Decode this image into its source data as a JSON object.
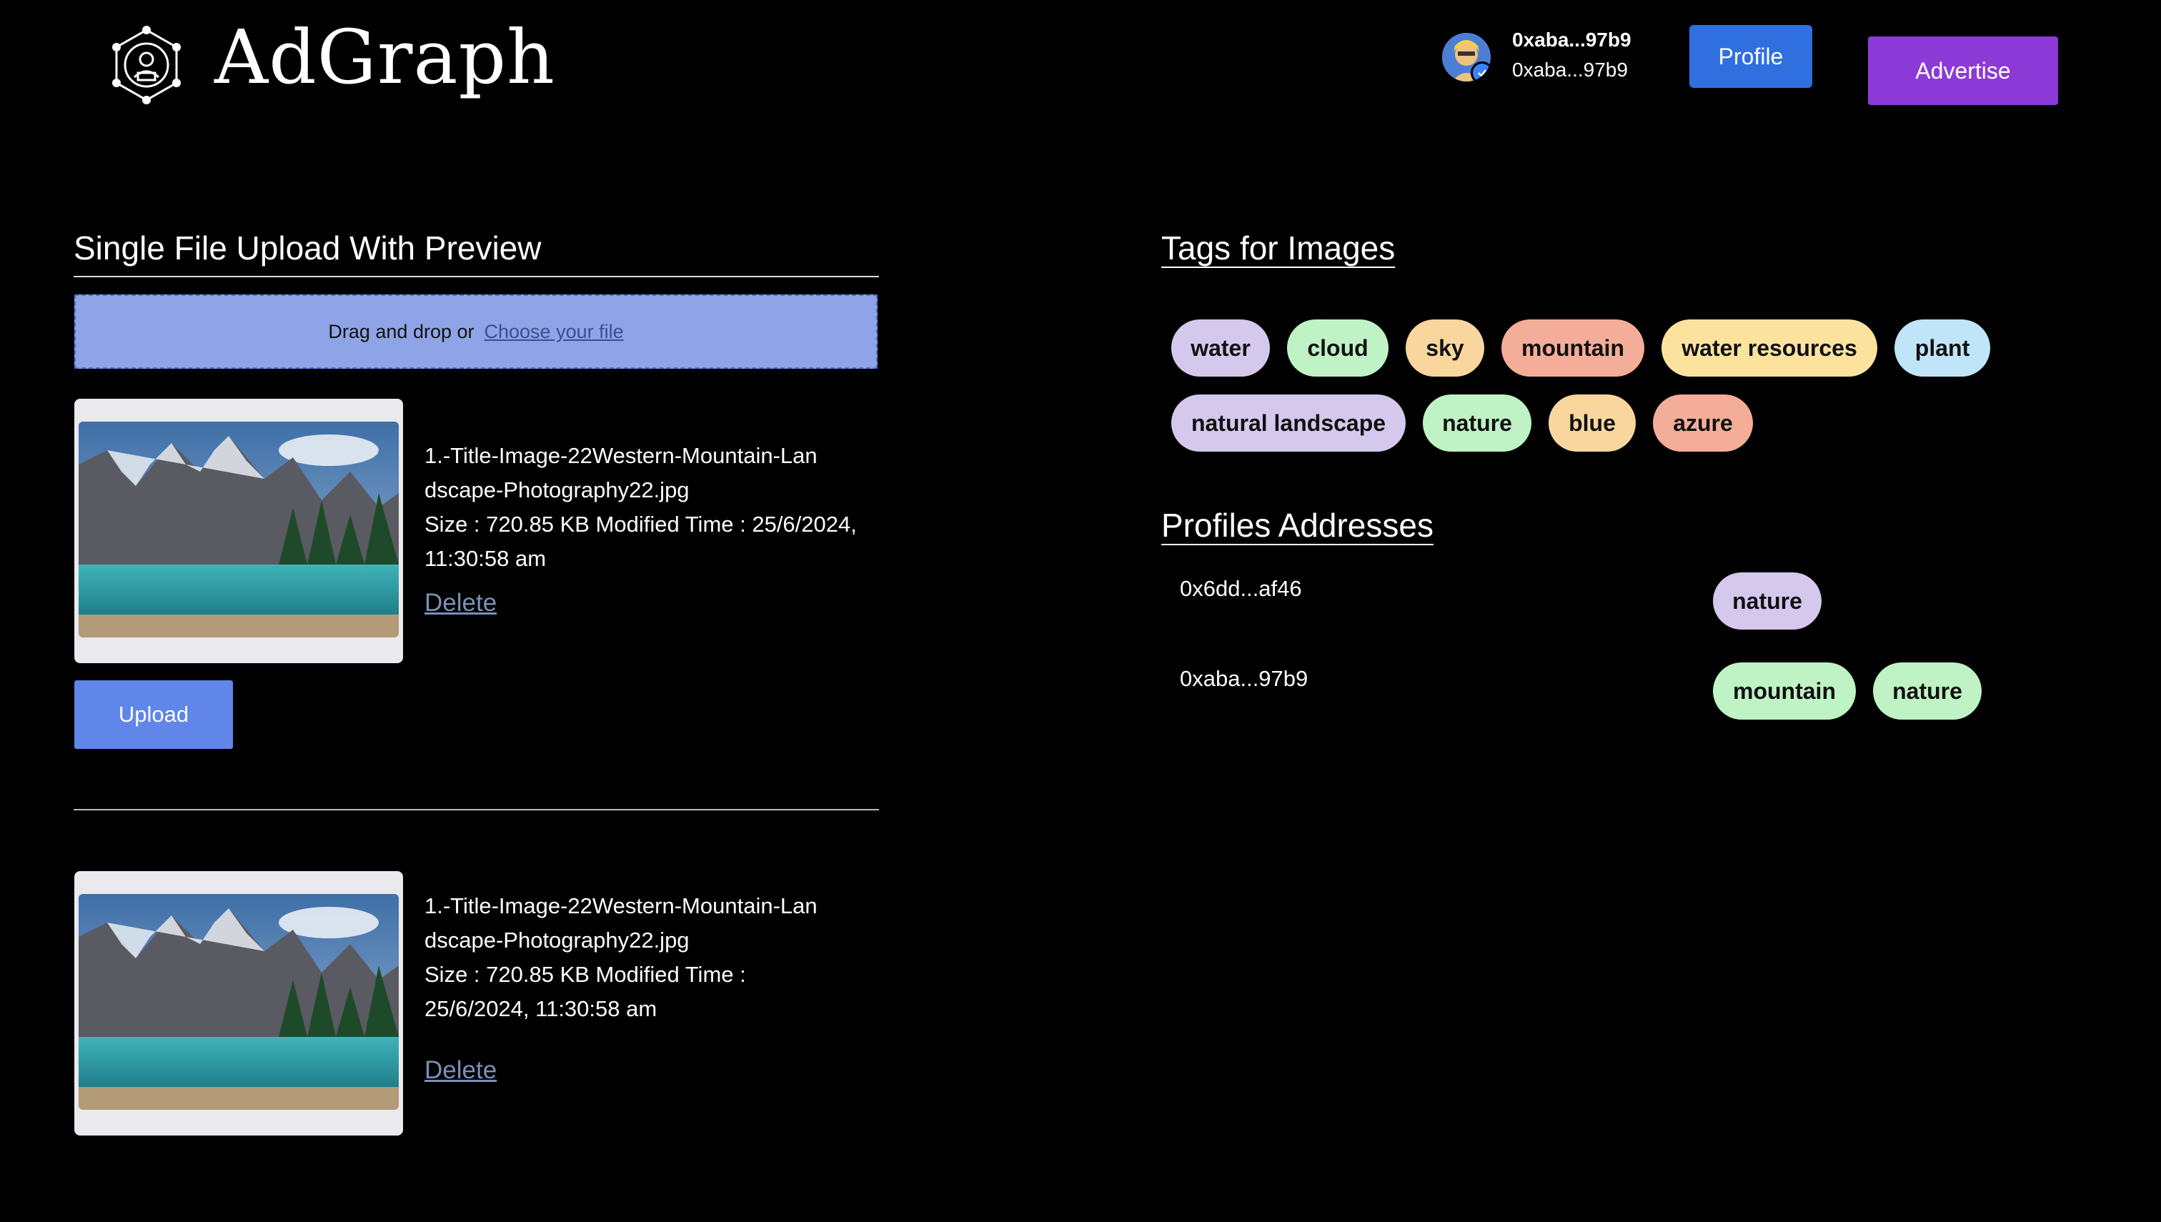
{
  "header": {
    "app_name": "AdGraph",
    "account_name": "0xaba...97b9",
    "account_address": "0xaba...97b9",
    "profile_label": "Profile",
    "advertise_label": "Advertise"
  },
  "upload": {
    "title": "Single File Upload With Preview",
    "drop_text": "Drag and drop or",
    "choose_text": "Choose your file",
    "upload_label": "Upload",
    "delete_label": "Delete",
    "files": [
      {
        "name": "1.-Title-Image-22Western-Mountain-Landscape-Photography22.jpg",
        "size_line": "Size : 720.85 KB  Modified Time : 25/6/2024, 11:30:58 am"
      },
      {
        "name": "1.-Title-Image-22Western-Mountain-Landscape-Photography22.jpg",
        "size_line": "Size : 720.85 KB   Modified Time : 25/6/2024, 11:30:58 am"
      }
    ]
  },
  "tags": {
    "title": "Tags for Images",
    "items": [
      {
        "label": "water",
        "color": "#d4c8ec"
      },
      {
        "label": "cloud",
        "color": "#bff2c4"
      },
      {
        "label": "sky",
        "color": "#f8d69e"
      },
      {
        "label": "mountain",
        "color": "#f3ad98"
      },
      {
        "label": "water resources",
        "color": "#fbe39e"
      },
      {
        "label": "plant",
        "color": "#c0e4f8"
      },
      {
        "label": "natural landscape",
        "color": "#d4c8ec"
      },
      {
        "label": "nature",
        "color": "#bff2c4"
      },
      {
        "label": "blue",
        "color": "#f8d69e"
      },
      {
        "label": "azure",
        "color": "#f3ad98"
      }
    ]
  },
  "profiles": {
    "title": "Profiles Addresses",
    "rows": [
      {
        "address": "0x6dd...af46",
        "tags": [
          {
            "label": "nature",
            "color": "#d4c8ec"
          }
        ]
      },
      {
        "address": "0xaba...97b9",
        "tags": [
          {
            "label": "mountain",
            "color": "#bff2c4"
          },
          {
            "label": "nature",
            "color": "#bff2c4"
          }
        ]
      }
    ]
  }
}
